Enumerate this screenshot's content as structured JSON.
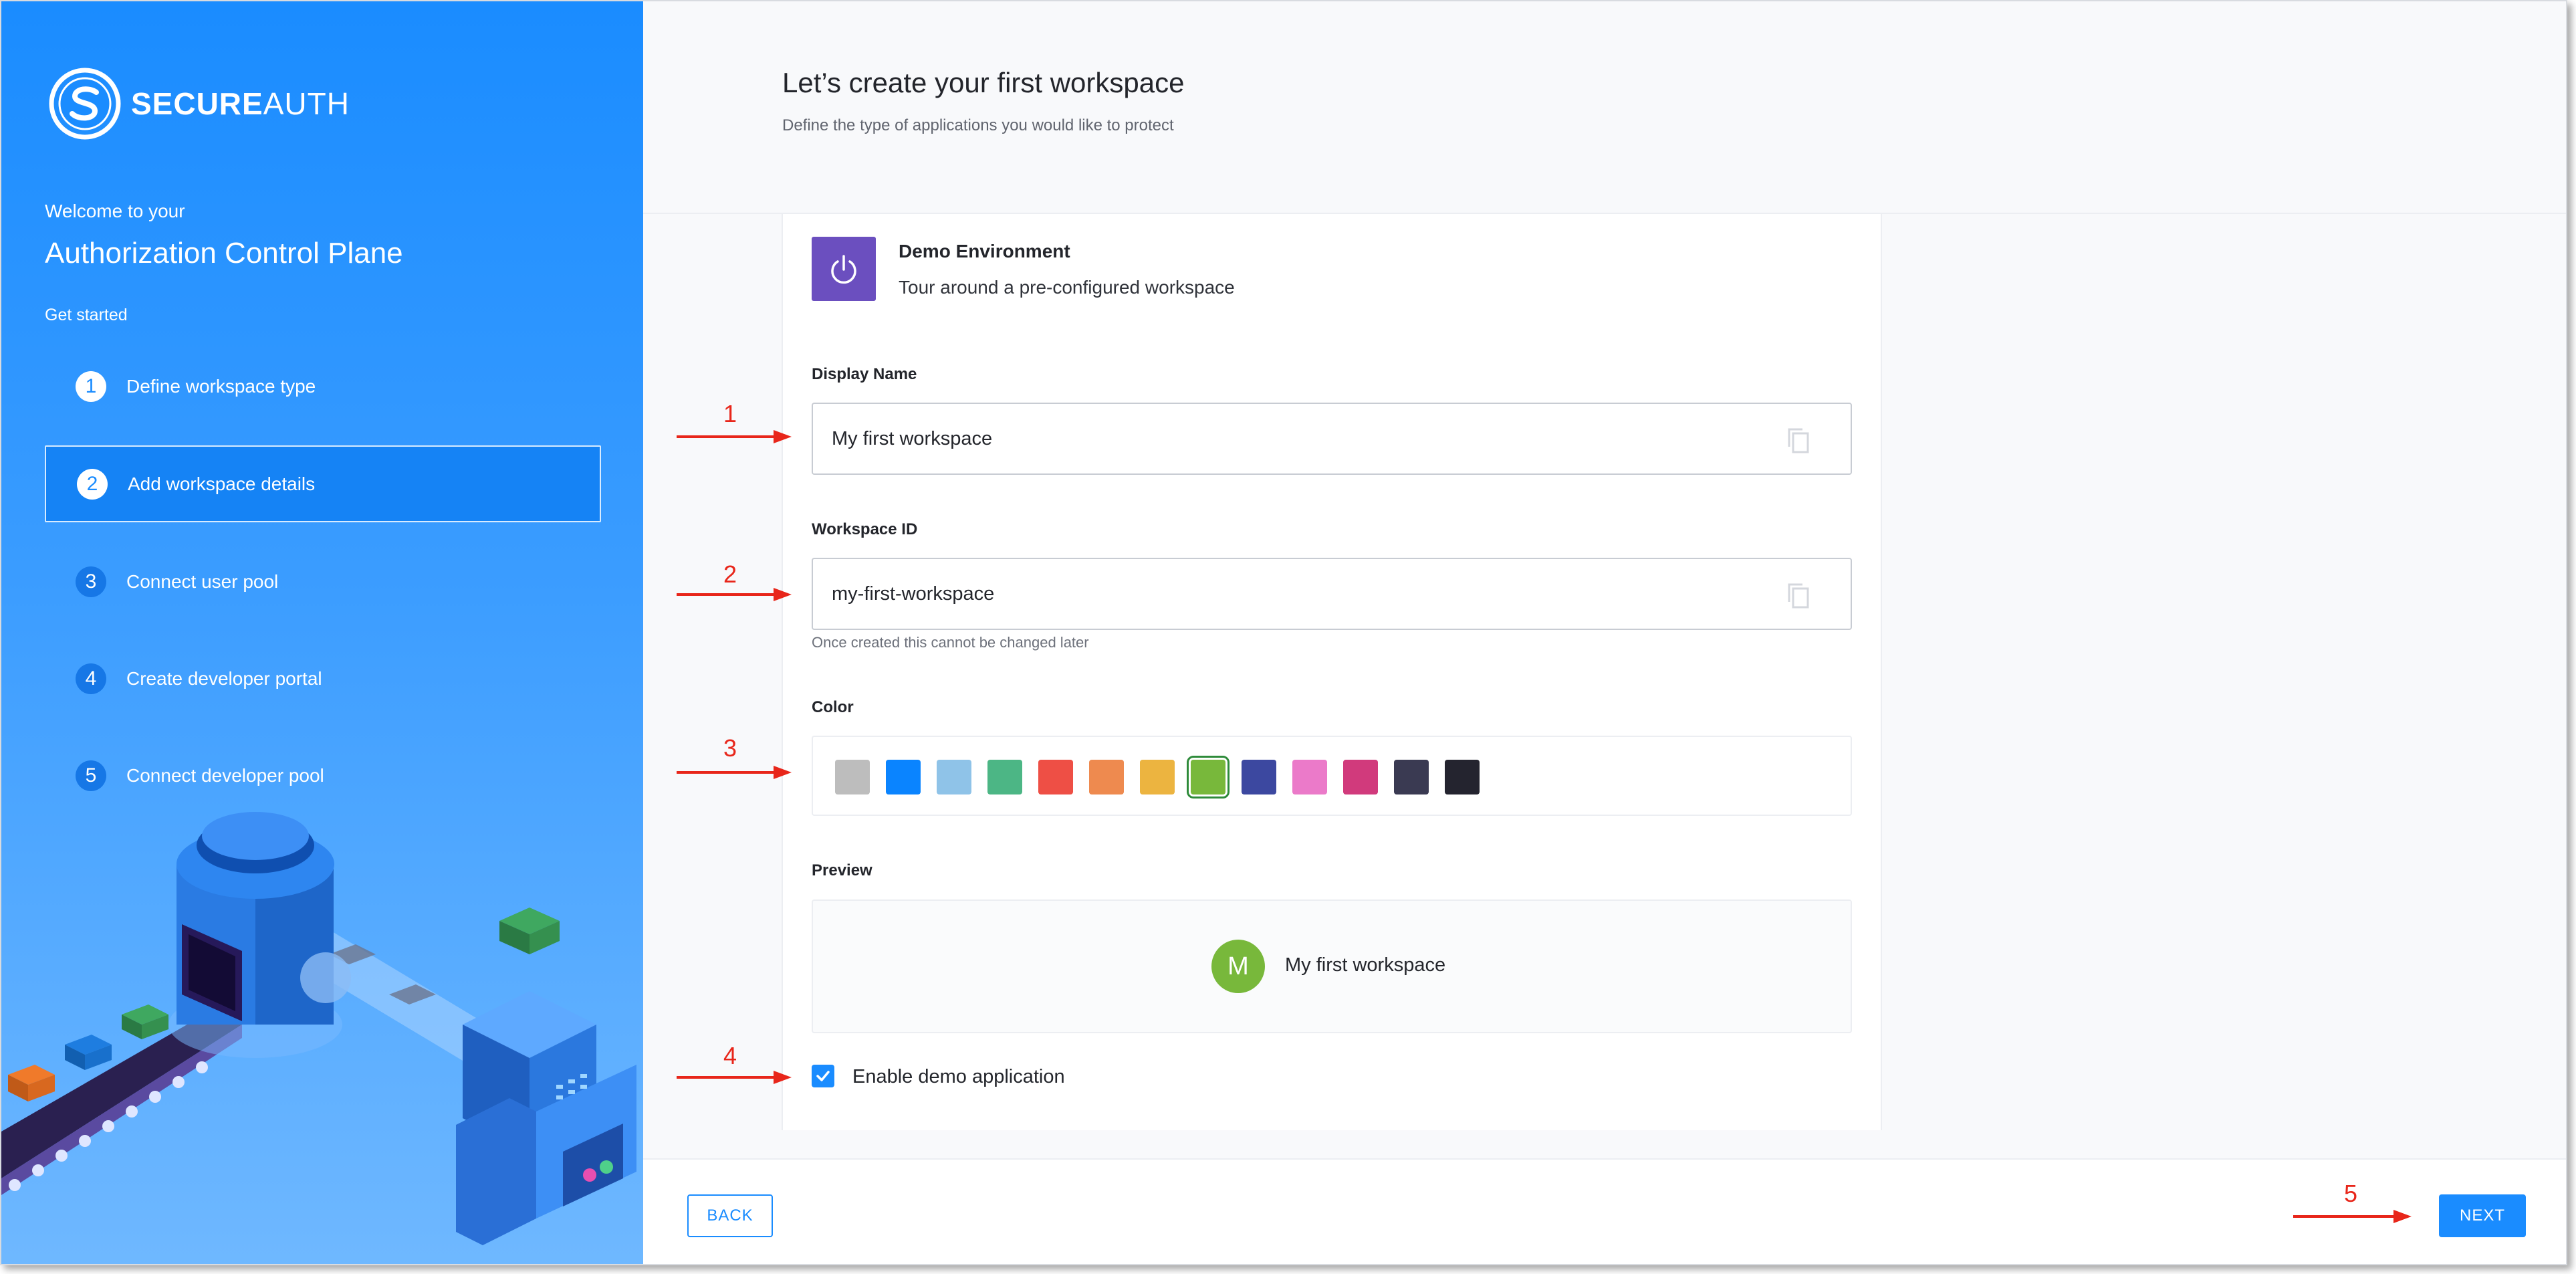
{
  "brand": {
    "name_bold": "SECURE",
    "name_light": "AUTH"
  },
  "sidebar": {
    "welcome": "Welcome to your",
    "title": "Authorization Control Plane",
    "get_started": "Get started",
    "steps": [
      {
        "num": "1",
        "label": "Define workspace type",
        "state": "done"
      },
      {
        "num": "2",
        "label": "Add workspace details",
        "state": "active"
      },
      {
        "num": "3",
        "label": "Connect user pool",
        "state": "todo"
      },
      {
        "num": "4",
        "label": "Create developer portal",
        "state": "todo"
      },
      {
        "num": "5",
        "label": "Connect developer pool",
        "state": "todo"
      }
    ]
  },
  "header": {
    "title": "Let’s create your first workspace",
    "subtitle": "Define the type of applications you would like to protect"
  },
  "workspace_type": {
    "icon": "power-icon",
    "title": "Demo Environment",
    "subtitle": "Tour around a pre-configured workspace"
  },
  "form": {
    "display_name": {
      "label": "Display Name",
      "value": "My first workspace"
    },
    "workspace_id": {
      "label": "Workspace ID",
      "value": "my-first-workspace",
      "hint": "Once created this cannot be changed later"
    },
    "color": {
      "label": "Color",
      "swatches": [
        "#bdbdbd",
        "#0a84ff",
        "#8fc3e8",
        "#4cb685",
        "#ee4f45",
        "#ee8a4f",
        "#ecb440",
        "#78b83b",
        "#3c48a0",
        "#eb7ac9",
        "#d13a7c",
        "#3a3a52",
        "#24242f"
      ],
      "selected_index": 7
    },
    "preview": {
      "label": "Preview",
      "avatar_letter": "M",
      "name": "My first workspace"
    },
    "demo_app": {
      "label": "Enable demo application",
      "checked": true
    }
  },
  "footer": {
    "back_label": "BACK",
    "next_label": "NEXT"
  },
  "annotations": {
    "color": "#e8261a",
    "labels": [
      "1",
      "2",
      "3",
      "4",
      "5"
    ]
  }
}
